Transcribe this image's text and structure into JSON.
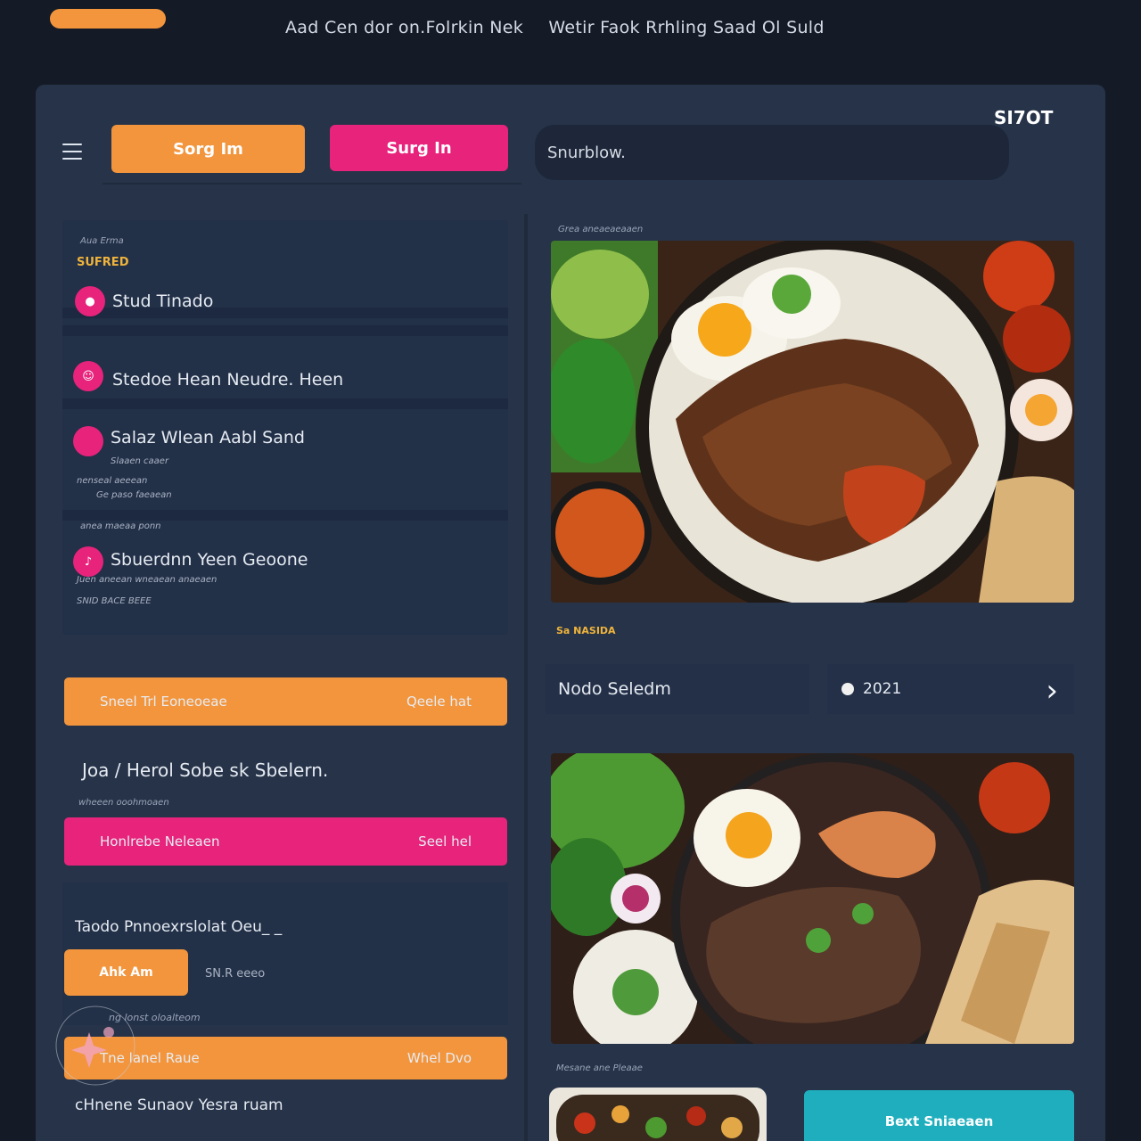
{
  "top": {
    "banner_1": "Aad Cen dor on.Folrkin Nek",
    "banner_2": "Wetir Faok Rrhling Saad Ol Suld"
  },
  "header": {
    "signin_label": "Sorg Im",
    "signup_label": "Surg In",
    "search_placeholder": "Snurblow.",
    "stop_label": "SI7OT"
  },
  "categories": {
    "small_title": "Aua Erma",
    "accent_title": "SUFRED",
    "items": [
      {
        "label": "Stud Tinado",
        "sub": ""
      },
      {
        "label": "Stedoe  Hean  Neudre. Heen",
        "sub": ""
      },
      {
        "label": "Salaz Wlean  Aabl Sand",
        "sub": "Slaaen caaer"
      },
      {
        "label": "Sbuerdnn Yeen Geoone",
        "sub": "Juen aneean wneaean anaeaen"
      }
    ],
    "extra_sub_1": "nenseal   aeeean",
    "extra_sub_2": "Ge paso faeaean",
    "group_label": "anea maeaa ponn",
    "extra_sub_3": "SNID BACE BEEE"
  },
  "actions": {
    "orange_bar_left": "Sneel Trl  Eoneoeae",
    "orange_bar_right": "Qeele hat",
    "info_text": "Joa / Herol Sobe sk  Sbelern.",
    "info_sub": "wheeen ooohmoaen",
    "pink_bar_left": "Honlrebe Neleaen",
    "pink_bar_right": "Seel hel"
  },
  "tracker": {
    "title": "Taodo Pnnoexrslolat Oeu_ _",
    "add_label": "Ahk Am",
    "add_meta": "SN.R eeeo",
    "add_meta_2": "ng lonst oloalteom",
    "orange_bar_left": "Tne lanel Raue",
    "orange_bar_right": "Whel Dvo",
    "footer_text": "cHnene Sunaov Yesra ruam"
  },
  "right": {
    "caption_1": "Grea aneaeaeaaen",
    "caption_2": "Sa NASIDA",
    "dish_name": "Nodo Seledm",
    "rating": "2021",
    "caption_3": "Mesane ane Pleaae",
    "teal_label": "Bext Sniaeaen"
  },
  "colors": {
    "background": "#151b26",
    "panel": "#263349",
    "orange": "#f2953d",
    "pink": "#e7237c",
    "teal": "#1faebe",
    "gold": "#f0b43b"
  },
  "icons": {
    "menu": "hamburger-icon",
    "rating": "dot-icon",
    "next": "chevron-right-icon",
    "watermark": "sparkle-logo"
  }
}
